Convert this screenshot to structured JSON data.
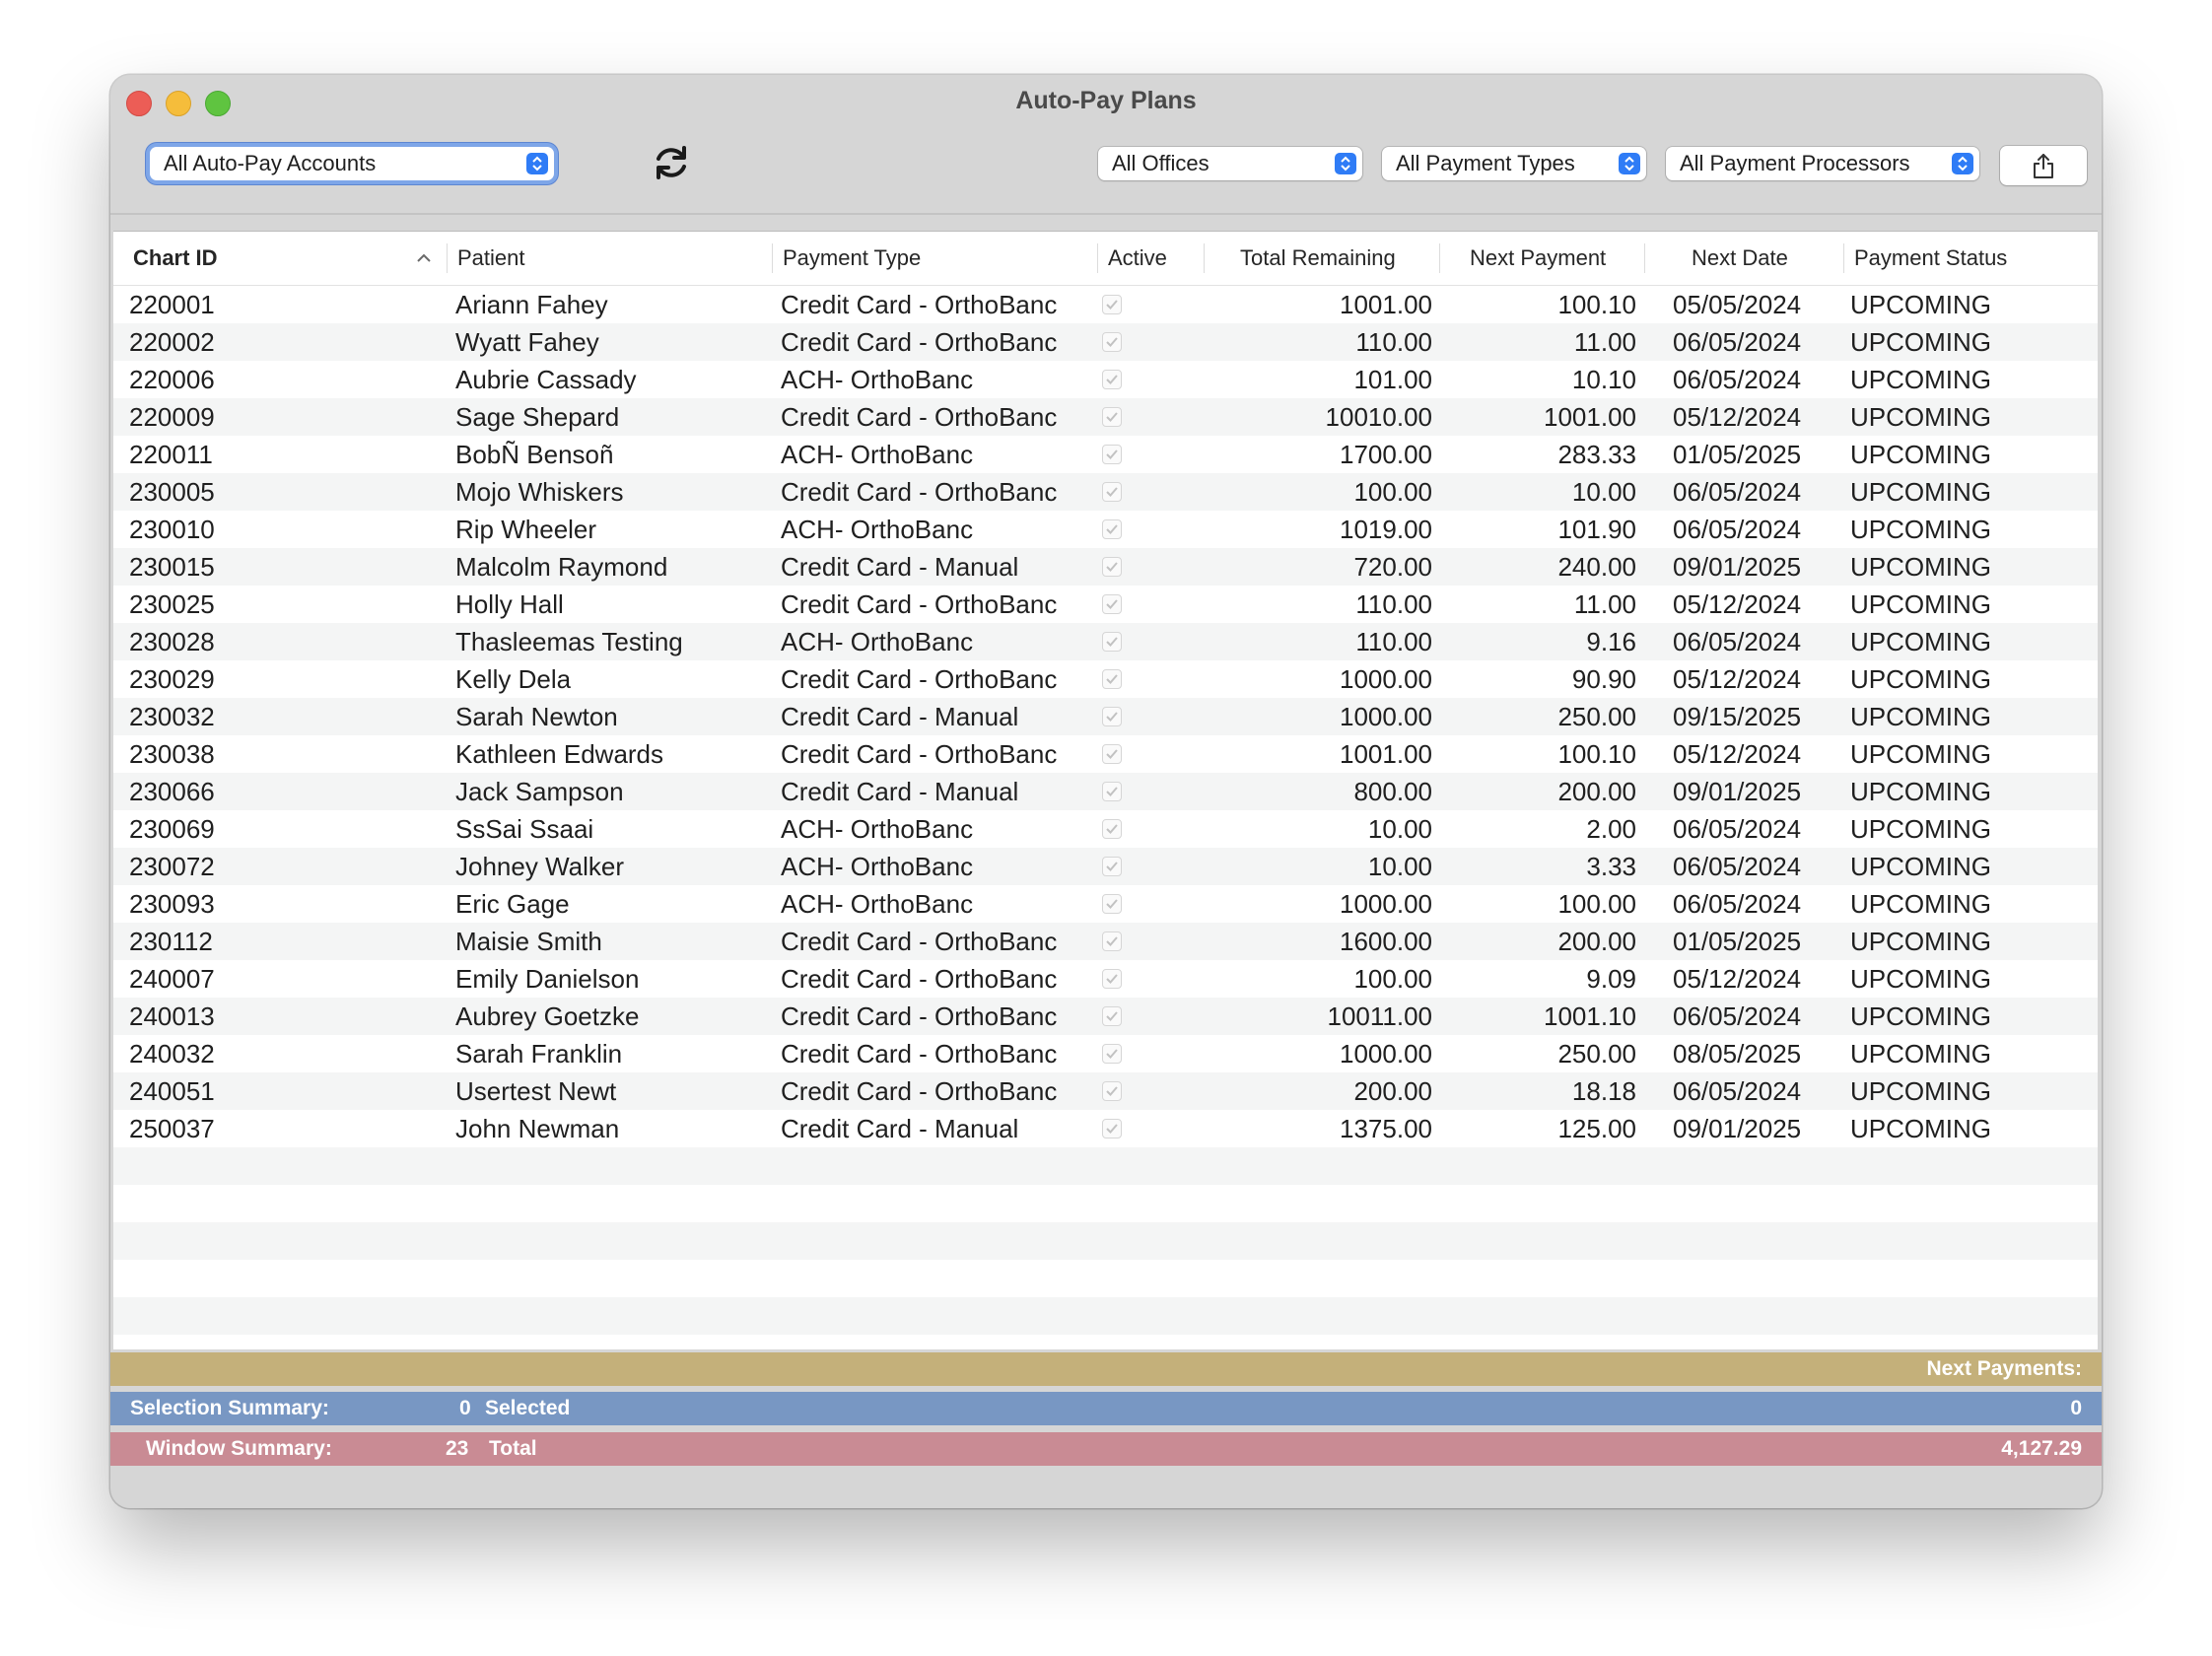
{
  "window": {
    "title": "Auto-Pay Plans"
  },
  "toolbar": {
    "accounts_filter": "All Auto-Pay Accounts",
    "offices_filter": "All Offices",
    "payment_types_filter": "All Payment Types",
    "processors_filter": "All Payment Processors",
    "refresh_icon": "refresh-icon",
    "share_icon": "share-icon"
  },
  "table": {
    "columns": [
      "Chart ID",
      "Patient",
      "Payment Type",
      "Active",
      "Total Remaining",
      "Next Payment",
      "Next Date",
      "Payment Status"
    ],
    "rows": [
      {
        "chart_id": "220001",
        "patient": "Ariann Fahey",
        "payment_type": "Credit Card - OrthoBanc",
        "total_remaining": "1001.00",
        "next_payment": "100.10",
        "next_date": "05/05/2024",
        "status": "UPCOMING"
      },
      {
        "chart_id": "220002",
        "patient": "Wyatt Fahey",
        "payment_type": "Credit Card - OrthoBanc",
        "total_remaining": "110.00",
        "next_payment": "11.00",
        "next_date": "06/05/2024",
        "status": "UPCOMING"
      },
      {
        "chart_id": "220006",
        "patient": "Aubrie Cassady",
        "payment_type": "ACH- OrthoBanc",
        "total_remaining": "101.00",
        "next_payment": "10.10",
        "next_date": "06/05/2024",
        "status": "UPCOMING"
      },
      {
        "chart_id": "220009",
        "patient": "Sage Shepard",
        "payment_type": "Credit Card - OrthoBanc",
        "total_remaining": "10010.00",
        "next_payment": "1001.00",
        "next_date": "05/12/2024",
        "status": "UPCOMING"
      },
      {
        "chart_id": "220011",
        "patient": "BobÑ Bensoñ",
        "payment_type": "ACH- OrthoBanc",
        "total_remaining": "1700.00",
        "next_payment": "283.33",
        "next_date": "01/05/2025",
        "status": "UPCOMING"
      },
      {
        "chart_id": "230005",
        "patient": "Mojo Whiskers",
        "payment_type": "Credit Card - OrthoBanc",
        "total_remaining": "100.00",
        "next_payment": "10.00",
        "next_date": "06/05/2024",
        "status": "UPCOMING"
      },
      {
        "chart_id": "230010",
        "patient": "Rip Wheeler",
        "payment_type": "ACH- OrthoBanc",
        "total_remaining": "1019.00",
        "next_payment": "101.90",
        "next_date": "06/05/2024",
        "status": "UPCOMING"
      },
      {
        "chart_id": "230015",
        "patient": "Malcolm Raymond",
        "payment_type": "Credit Card - Manual",
        "total_remaining": "720.00",
        "next_payment": "240.00",
        "next_date": "09/01/2025",
        "status": "UPCOMING"
      },
      {
        "chart_id": "230025",
        "patient": "Holly Hall",
        "payment_type": "Credit Card - OrthoBanc",
        "total_remaining": "110.00",
        "next_payment": "11.00",
        "next_date": "05/12/2024",
        "status": "UPCOMING"
      },
      {
        "chart_id": "230028",
        "patient": "Thasleemas Testing",
        "payment_type": "ACH- OrthoBanc",
        "total_remaining": "110.00",
        "next_payment": "9.16",
        "next_date": "06/05/2024",
        "status": "UPCOMING"
      },
      {
        "chart_id": "230029",
        "patient": "Kelly Dela",
        "payment_type": "Credit Card - OrthoBanc",
        "total_remaining": "1000.00",
        "next_payment": "90.90",
        "next_date": "05/12/2024",
        "status": "UPCOMING"
      },
      {
        "chart_id": "230032",
        "patient": "Sarah Newton",
        "payment_type": "Credit Card - Manual",
        "total_remaining": "1000.00",
        "next_payment": "250.00",
        "next_date": "09/15/2025",
        "status": "UPCOMING"
      },
      {
        "chart_id": "230038",
        "patient": "Kathleen Edwards",
        "payment_type": "Credit Card - OrthoBanc",
        "total_remaining": "1001.00",
        "next_payment": "100.10",
        "next_date": "05/12/2024",
        "status": "UPCOMING"
      },
      {
        "chart_id": "230066",
        "patient": "Jack Sampson",
        "payment_type": "Credit Card - Manual",
        "total_remaining": "800.00",
        "next_payment": "200.00",
        "next_date": "09/01/2025",
        "status": "UPCOMING"
      },
      {
        "chart_id": "230069",
        "patient": "SsSai Ssaai",
        "payment_type": "ACH- OrthoBanc",
        "total_remaining": "10.00",
        "next_payment": "2.00",
        "next_date": "06/05/2024",
        "status": "UPCOMING"
      },
      {
        "chart_id": "230072",
        "patient": "Johney Walker",
        "payment_type": "ACH- OrthoBanc",
        "total_remaining": "10.00",
        "next_payment": "3.33",
        "next_date": "06/05/2024",
        "status": "UPCOMING"
      },
      {
        "chart_id": "230093",
        "patient": "Eric Gage",
        "payment_type": "ACH- OrthoBanc",
        "total_remaining": "1000.00",
        "next_payment": "100.00",
        "next_date": "06/05/2024",
        "status": "UPCOMING"
      },
      {
        "chart_id": "230112",
        "patient": "Maisie Smith",
        "payment_type": "Credit Card - OrthoBanc",
        "total_remaining": "1600.00",
        "next_payment": "200.00",
        "next_date": "01/05/2025",
        "status": "UPCOMING"
      },
      {
        "chart_id": "240007",
        "patient": "Emily Danielson",
        "payment_type": "Credit Card - OrthoBanc",
        "total_remaining": "100.00",
        "next_payment": "9.09",
        "next_date": "05/12/2024",
        "status": "UPCOMING"
      },
      {
        "chart_id": "240013",
        "patient": "Aubrey Goetzke",
        "payment_type": "Credit Card - OrthoBanc",
        "total_remaining": "10011.00",
        "next_payment": "1001.10",
        "next_date": "06/05/2024",
        "status": "UPCOMING"
      },
      {
        "chart_id": "240032",
        "patient": "Sarah Franklin",
        "payment_type": "Credit Card - OrthoBanc",
        "total_remaining": "1000.00",
        "next_payment": "250.00",
        "next_date": "08/05/2025",
        "status": "UPCOMING"
      },
      {
        "chart_id": "240051",
        "patient": "Usertest Newt",
        "payment_type": "Credit Card - OrthoBanc",
        "total_remaining": "200.00",
        "next_payment": "18.18",
        "next_date": "06/05/2024",
        "status": "UPCOMING"
      },
      {
        "chart_id": "250037",
        "patient": "John Newman",
        "payment_type": "Credit Card - Manual",
        "total_remaining": "1375.00",
        "next_payment": "125.00",
        "next_date": "09/01/2025",
        "status": "UPCOMING"
      }
    ]
  },
  "summary": {
    "next_payments_label": "Next Payments:",
    "selection_label": "Selection Summary:",
    "selection_count": "0",
    "selection_unit": "Selected",
    "selection_value": "0",
    "window_label": "Window Summary:",
    "window_count": "23",
    "window_unit": "Total",
    "window_value": "4,127.29"
  },
  "colors": {
    "next_band": "#c4b07a",
    "selection_band": "#7897c3",
    "window_band": "#c98b94",
    "accent": "#2f7cf6"
  }
}
